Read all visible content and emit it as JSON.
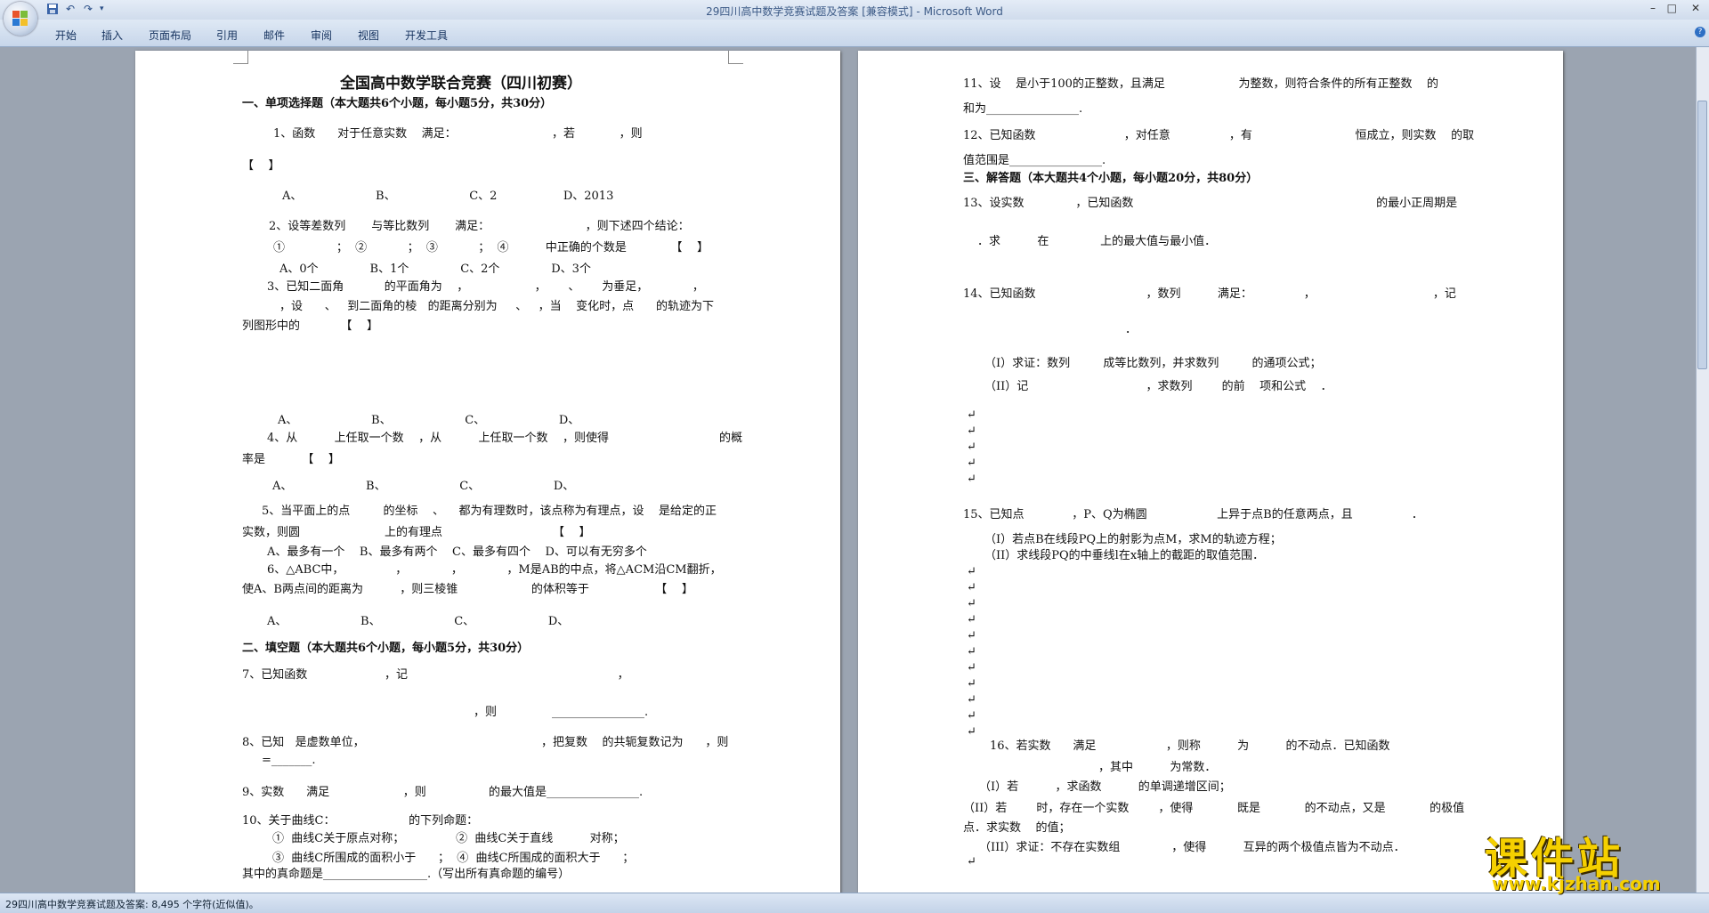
{
  "window": {
    "title": "29四川高中数学竞赛试题及答案 [兼容模式] - Microsoft Word",
    "controls": {
      "minimize": "–",
      "maximize": "□",
      "close": "✕"
    }
  },
  "ribbon": {
    "tabs": [
      "开始",
      "插入",
      "页面布局",
      "引用",
      "邮件",
      "审阅",
      "视图",
      "开发工具"
    ],
    "help": "?"
  },
  "quick_access": {
    "save_icon": "save-icon",
    "undo_icon": "undo-icon",
    "redo_icon": "redo-icon"
  },
  "left_page": {
    "lines": [
      "全国高中数学联合竞赛（四川初赛）",
      "一、单项选择题（本大题共6个小题，每小题5分，共30分）",
      "1、函数      对于任意实数    满足：                          ，若            ，则",
      "【    】",
      "A、                    B、                    C、2                  D、2013",
      "2、设等差数列       与等比数列       满足：                          ，则下述四个结论：",
      "①              ；  ②           ；  ③           ；  ④          中正确的个数是            【    】",
      "A、0个              B、1个              C、2个              D、3个",
      "3、已知二面角           的平面角为    ，                  ，      、      为垂足，            ，",
      "，设      、   到二面角的棱   的距离分别为     、   ，当    变化时，点      的轨迹为下",
      "列图形中的           【    】",
      "A、                    B、                    C、                    D、",
      "4、从          上任取一个数    ，从          上任取一个数    ，则使得                              的概",
      "率是          【    】",
      "A、                    B、                    C、                    D、",
      "5、当平面上的点         的坐标    、    都为有理数时，该点称为有理点，设    是给定的正",
      "实数，则圆                       上的有理点                              【    】",
      "A、最多有一个    B、最多有两个    C、最多有四个    D、可以有无穷多个",
      "6、△ABC中，              ，            ，            ，M是AB的中点，将△ACM沿CM翻折，",
      "使A、B两点间的距离为          ，则三棱锥                    的体积等于                  【    】",
      "A、                    B、                    C、                    D、",
      "二、填空题（本大题共6个小题，每小题5分，共30分）",
      "7、已知函数                     ，记                                                         ，",
      "，则               ________________.",
      "8、已知   是虚数单位，                                                ，把复数    的共轭复数记为      ，则",
      "=_______.",
      "9、实数      满足                    ，则                 的最大值是________________.",
      "10、关于曲线C：                    的下列命题：",
      "①  曲线C关于原点对称；              ②  曲线C关于直线          对称；",
      "③  曲线C所围成的面积小于      ；  ④  曲线C所围成的面积大于      ；",
      "其中的真命题是__________________.（写出所有真命题的编号）"
    ]
  },
  "right_page": {
    "lines": [
      "11、设    是小于100的正整数，且满足                    为整数，则符合条件的所有正整数    的",
      "和为________________.",
      "12、已知函数                        ，对任意                ，有                            恒成立，则实数    的取",
      "值范围是________________.",
      "三、解答题（本大题共4个小题，每小题20分，共80分）",
      "13、设实数              ，已知函数                                                                  的最小正周期是",
      "．求          在              上的最大值与最小值．",
      "14、已知函数                              ，数列          满足：              ，                                ，记",
      "．",
      "（I）求证：数列         成等比数列，并求数列         的通项公式；",
      "（II）记                                ，求数列        的前    项和公式    ．",
      "15、已知点             ，P、Q为椭圆                   上异于点B的任意两点，且                ．",
      "（I）若点B在线段PQ上的射影为点M，求M的轨迹方程；",
      "（II）求线段PQ的中垂线l在x轴上的截距的取值范围．",
      "16、若实数      满足                   ，则称          为          的不动点．已知函数",
      "，其中          为常数．",
      "（I）若          ，求函数          的单调递增区间；",
      "（II）若        时，存在一个实数        ，使得            既是            的不动点，又是            的极值",
      "点．求实数    的值；",
      "（III）求证：不存在实数组              ，使得          互异的两个极值点皆为不动点．"
    ],
    "para_marks": [
      "↵",
      "↵",
      "↵",
      "↵",
      "↵",
      "↵",
      "↵",
      "↵",
      "↵",
      "↵",
      "↵",
      "↵",
      "↵",
      "↵",
      "↵",
      "↵",
      "↵",
      "↵",
      "↵"
    ]
  },
  "status": {
    "text": "29四川高中数学竞赛试题及答案: 8,495 个字符(近似值)。"
  },
  "watermark": {
    "cn": "课件站",
    "url": "www.kjzhan.com"
  }
}
